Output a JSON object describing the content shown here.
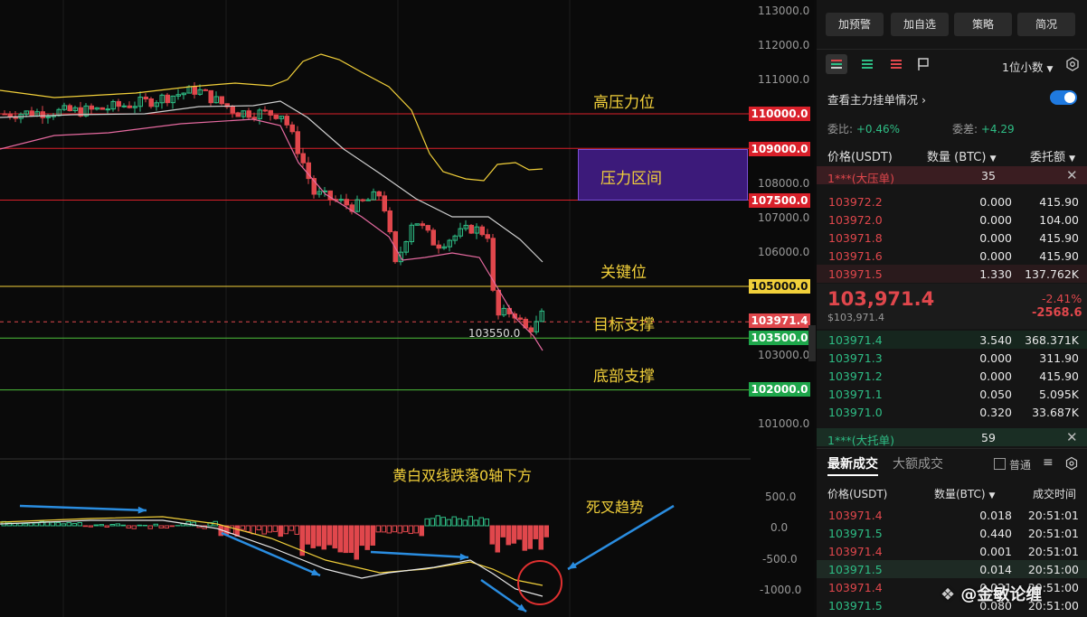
{
  "chart": {
    "axis_labels": [
      "113000.0",
      "112000.0",
      "111000.0",
      "110000.0",
      "109000.0",
      "108000.0",
      "107000.0",
      "106000.0",
      "105000.0",
      "103971.4",
      "103500.0",
      "103000.0",
      "102000.0",
      "101000.0"
    ],
    "price_tags": {
      "p110000": "110000.0",
      "p109000": "109000.0",
      "p107500": "107500.0",
      "p105000": "105000.0",
      "p103971": "103971.4",
      "p103500": "103500.0",
      "p102000": "102000.0"
    },
    "low_label": "103550.0",
    "annotations": {
      "high_pressure": "高压力位",
      "pressure_zone": "压力区间",
      "key_level": "关键位",
      "target_support": "目标支撑",
      "bottom_support": "底部支撑"
    },
    "macd": {
      "title": "黄白双线跌落0轴下方",
      "death_cross": "死叉趋势",
      "axis": [
        "500.0",
        "0.0",
        "-500.0",
        "-1000.0"
      ]
    },
    "colors": {
      "up": "#2ebd85",
      "down": "#e0474c",
      "yellow_line": "#f2d03a",
      "purple_zone": "#3c1a7a"
    },
    "watermark": "@金敏论缠"
  },
  "panel": {
    "buttons": [
      "加预警",
      "加自选",
      "策略",
      "简况"
    ],
    "decimal": "1位小数",
    "main_orders": "查看主力挂单情况",
    "commission_ratio_label": "委比:",
    "commission_ratio": "+0.46%",
    "commission_diff_label": "委差:",
    "commission_diff": "+4.29",
    "headers": {
      "price": "价格(USDT)",
      "qty": "数量 (BTC)",
      "amount": "委托额"
    },
    "big_ask": {
      "label": "1***(大压单)",
      "count": "35"
    },
    "asks": [
      {
        "p": "103972.2",
        "q": "0.000",
        "a": "415.90"
      },
      {
        "p": "103972.0",
        "q": "0.000",
        "a": "104.00"
      },
      {
        "p": "103971.8",
        "q": "0.000",
        "a": "415.90"
      },
      {
        "p": "103971.6",
        "q": "0.000",
        "a": "415.90"
      },
      {
        "p": "103971.5",
        "q": "1.330",
        "a": "137.762K"
      }
    ],
    "last_price": "103,971.4",
    "last_price_usd": "$103,971.4",
    "change_pct": "-2.41%",
    "change_abs": "-2568.6",
    "bids": [
      {
        "p": "103971.4",
        "q": "3.540",
        "a": "368.371K"
      },
      {
        "p": "103971.3",
        "q": "0.000",
        "a": "311.90"
      },
      {
        "p": "103971.2",
        "q": "0.000",
        "a": "415.90"
      },
      {
        "p": "103971.1",
        "q": "0.050",
        "a": "5.095K"
      },
      {
        "p": "103971.0",
        "q": "0.320",
        "a": "33.687K"
      }
    ],
    "big_bid": {
      "label": "1***(大托单)",
      "count": "59"
    },
    "tabs": {
      "latest": "最新成交",
      "large": "大额成交",
      "normal": "普通"
    },
    "trade_headers": {
      "price": "价格(USDT)",
      "qty": "数量(BTC)",
      "time": "成交时间"
    },
    "trades": [
      {
        "p": "103971.4",
        "q": "0.018",
        "t": "20:51:01",
        "side": "red"
      },
      {
        "p": "103971.5",
        "q": "0.440",
        "t": "20:51:01",
        "side": "green"
      },
      {
        "p": "103971.4",
        "q": "0.001",
        "t": "20:51:01",
        "side": "red"
      },
      {
        "p": "103971.5",
        "q": "0.014",
        "t": "20:51:00",
        "side": "green"
      },
      {
        "p": "103971.4",
        "q": "0.021",
        "t": "20:51:00",
        "side": "red"
      },
      {
        "p": "103971.5",
        "q": "0.080",
        "t": "20:51:00",
        "side": "green"
      }
    ]
  }
}
